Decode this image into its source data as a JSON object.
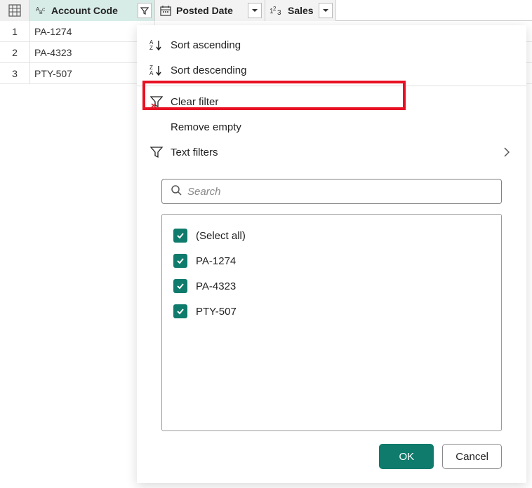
{
  "columns": [
    {
      "label": "Account Code",
      "type": "text",
      "filtered": true,
      "active": true
    },
    {
      "label": "Posted Date",
      "type": "date",
      "filtered": false,
      "active": false
    },
    {
      "label": "Sales",
      "type": "number",
      "filtered": false,
      "active": false
    }
  ],
  "rows": [
    {
      "num": "1",
      "val": "PA-1274"
    },
    {
      "num": "2",
      "val": "PA-4323"
    },
    {
      "num": "3",
      "val": "PTY-507"
    }
  ],
  "menu": {
    "sort_asc": "Sort ascending",
    "sort_desc": "Sort descending",
    "clear_filter": "Clear filter",
    "remove_empty": "Remove empty",
    "text_filters": "Text filters"
  },
  "search": {
    "placeholder": "Search"
  },
  "filter_items": [
    {
      "label": "(Select all)",
      "checked": true
    },
    {
      "label": "PA-1274",
      "checked": true
    },
    {
      "label": "PA-4323",
      "checked": true
    },
    {
      "label": "PTY-507",
      "checked": true
    }
  ],
  "buttons": {
    "ok": "OK",
    "cancel": "Cancel"
  }
}
